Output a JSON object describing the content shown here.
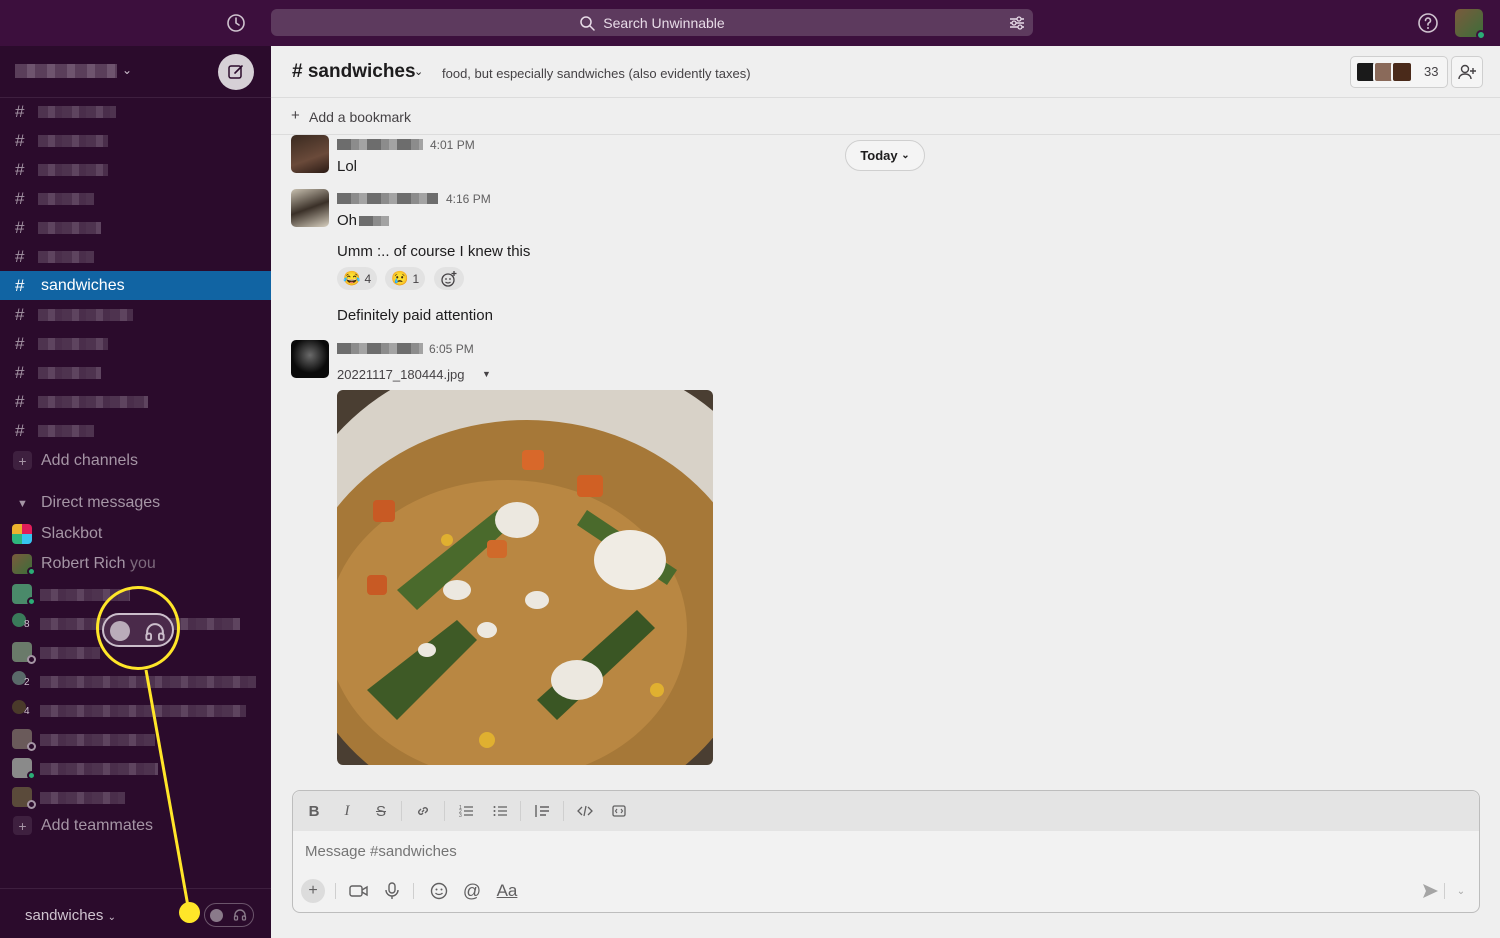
{
  "search": {
    "placeholder": "Search Unwinnable"
  },
  "sidebar": {
    "active_channel": "sandwiches",
    "add_channels": "Add channels",
    "direct_messages_label": "Direct messages",
    "dms": [
      {
        "name": "Slackbot"
      },
      {
        "name": "Robert Rich",
        "suffix": "you"
      }
    ],
    "badges": [
      "8",
      "2",
      "4"
    ],
    "add_teammates": "Add teammates",
    "footer_label": "sandwiches"
  },
  "channel": {
    "title": "# sandwiches",
    "topic": "food, but especially sandwiches (also evidently taxes)",
    "member_count": "33",
    "bookmark_label": "Add a bookmark"
  },
  "messages": {
    "today_label": "Today",
    "m1": {
      "time": "4:01 PM",
      "text": "Lol"
    },
    "m2": {
      "time": "4:16 PM",
      "text": "Oh",
      "text2": "Umm :.. of course I knew this",
      "text3": "Definitely paid attention"
    },
    "reactions": [
      {
        "emoji": "😂",
        "count": "4"
      },
      {
        "emoji": "😢",
        "count": "1"
      }
    ],
    "m3": {
      "time": "6:05 PM",
      "file_name": "20221117_180444.jpg"
    }
  },
  "composer": {
    "placeholder": "Message #sandwiches",
    "format_label": "Aa"
  },
  "colors": {
    "aubergine": "#3c0f3d",
    "sidebar": "#2b0b2c",
    "active": "#1164a3",
    "callout": "#ffe629",
    "online": "#2bac76"
  }
}
